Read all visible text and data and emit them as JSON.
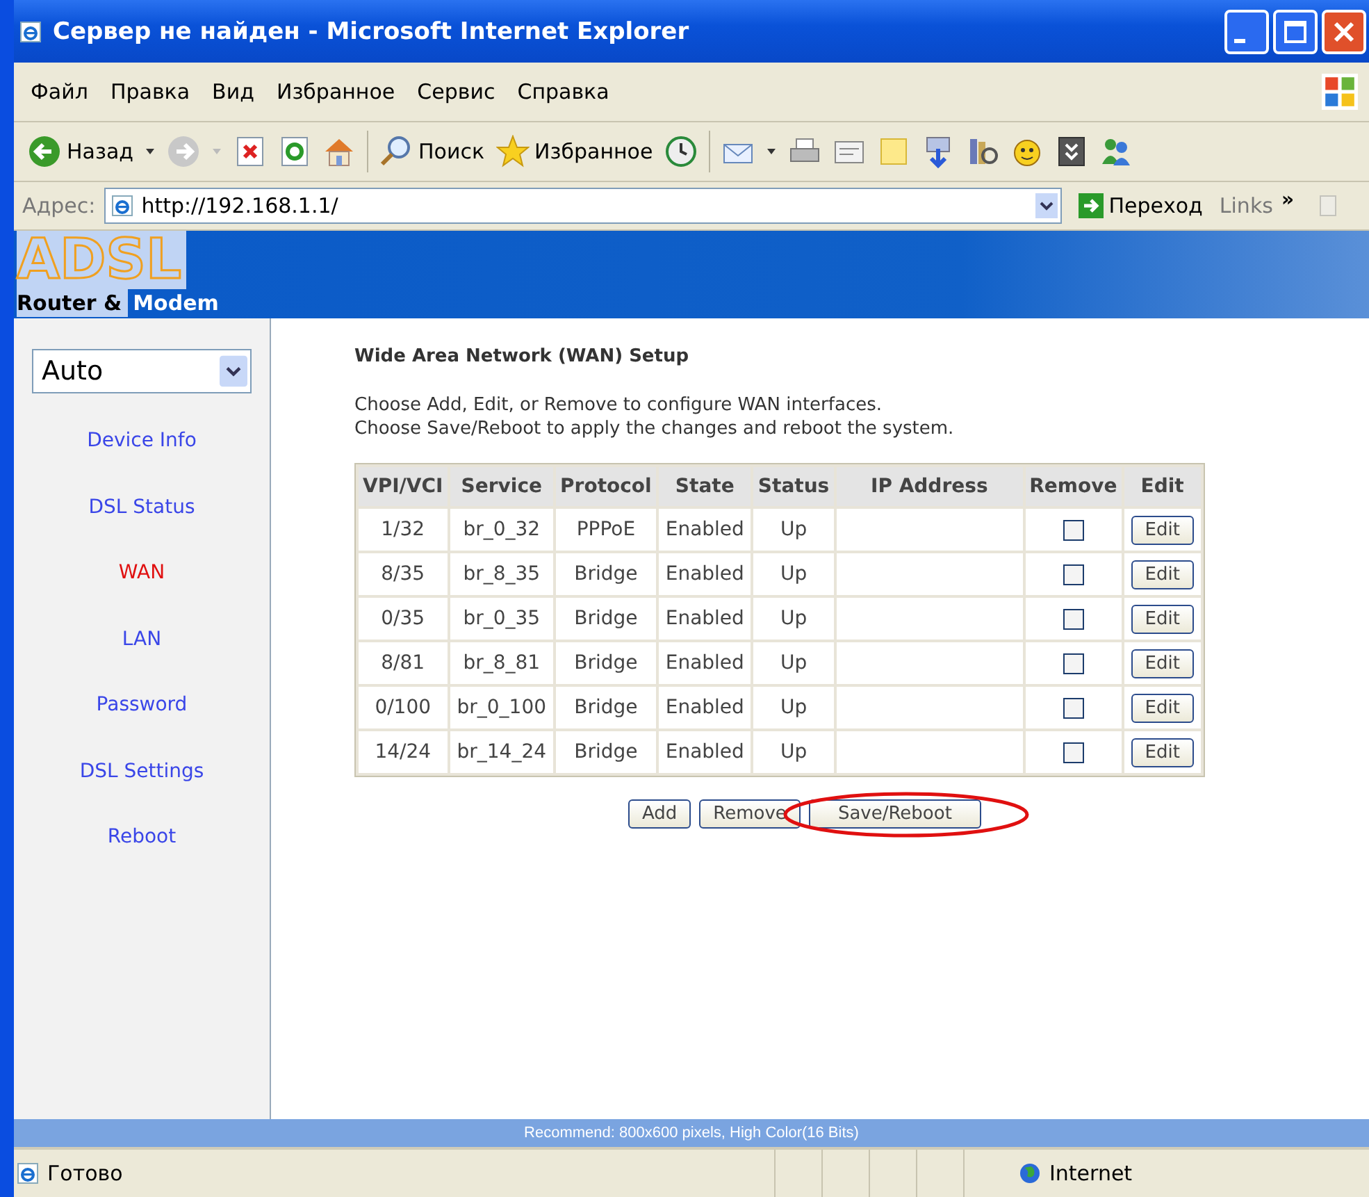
{
  "window": {
    "title": "Сервер не найден - Microsoft Internet Explorer"
  },
  "menu": [
    "Файл",
    "Правка",
    "Вид",
    "Избранное",
    "Сервис",
    "Справка"
  ],
  "toolbar": {
    "back": "Назад",
    "search": "Поиск",
    "favorites": "Избранное"
  },
  "address_bar": {
    "label": "Адрес:",
    "value": "http://192.168.1.1/",
    "go": "Переход",
    "links": "Links",
    "more": "»"
  },
  "logo": {
    "title": "ADSL",
    "subtitle_left": "Router &",
    "subtitle_right": "Modem"
  },
  "sidebar": {
    "select": "Auto",
    "items": [
      {
        "label": "Device Info",
        "selected": false
      },
      {
        "label": "DSL Status",
        "selected": false
      },
      {
        "label": "WAN",
        "selected": true
      },
      {
        "label": "LAN",
        "selected": false
      },
      {
        "label": "Password",
        "selected": false
      },
      {
        "label": "DSL Settings",
        "selected": false
      },
      {
        "label": "Reboot",
        "selected": false
      }
    ]
  },
  "main": {
    "title": "Wide Area Network (WAN) Setup",
    "intro": [
      "Choose Add, Edit, or Remove to configure WAN interfaces.",
      "Choose Save/Reboot to apply the changes and reboot the system."
    ],
    "table": {
      "columns": [
        "VPI/VCI",
        "Service",
        "Protocol",
        "State",
        "Status",
        "IP Address",
        "Remove",
        "Edit"
      ],
      "rows": [
        {
          "vpi_vci": "1/32",
          "service": "br_0_32",
          "protocol": "PPPoE",
          "state": "Enabled",
          "status": "Up",
          "remove_checked": false,
          "edit": "Edit"
        },
        {
          "vpi_vci": "8/35",
          "service": "br_8_35",
          "protocol": "Bridge",
          "state": "Enabled",
          "status": "Up",
          "remove_checked": false,
          "edit": "Edit"
        },
        {
          "vpi_vci": "0/35",
          "service": "br_0_35",
          "protocol": "Bridge",
          "state": "Enabled",
          "status": "Up",
          "remove_checked": false,
          "edit": "Edit"
        },
        {
          "vpi_vci": "8/81",
          "service": "br_8_81",
          "protocol": "Bridge",
          "state": "Enabled",
          "status": "Up",
          "remove_checked": false,
          "edit": "Edit"
        },
        {
          "vpi_vci": "0/100",
          "service": "br_0_100",
          "protocol": "Bridge",
          "state": "Enabled",
          "status": "Up",
          "remove_checked": false,
          "edit": "Edit"
        },
        {
          "vpi_vci": "14/24",
          "service": "br_14_24",
          "protocol": "Bridge",
          "state": "Enabled",
          "status": "Up",
          "remove_checked": false,
          "edit": "Edit"
        }
      ]
    },
    "buttons": [
      "Add",
      "Remove",
      "Save/Reboot"
    ]
  },
  "footer": "Recommend: 800x600 pixels, High Color(16 Bits)",
  "status_bar": {
    "text": "Готово",
    "zone": "Internet"
  }
}
